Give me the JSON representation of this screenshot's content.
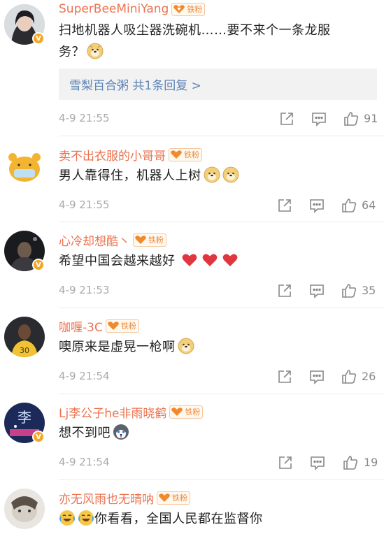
{
  "comments": [
    {
      "username": "SuperBeeMiniYang",
      "badge": "铁粉",
      "text": "扫地机器人吸尘器洗碗机……要不来个一条龙服务？",
      "emoticons": [
        "doge"
      ],
      "reply_link": "雪梨百合粥  共1条回复 >",
      "time": "4-9 21:55",
      "likes": "91",
      "verified": "V"
    },
    {
      "username": "卖不出衣服的小哥哥",
      "badge": "铁粉",
      "text": "男人靠得住，机器人上树",
      "emoticons": [
        "doge",
        "doge"
      ],
      "time": "4-9 21:55",
      "likes": "64"
    },
    {
      "username": "心冷却想酷丶",
      "badge": "铁粉",
      "text": "希望中国会越来越好",
      "emoticons": [
        "heart",
        "heart",
        "heart"
      ],
      "time": "4-9 21:53",
      "likes": "35",
      "verified": "V"
    },
    {
      "username": "咖喱-3C",
      "badge": "铁粉",
      "text": "噢原来是虚晃一枪啊",
      "emoticons": [
        "doge"
      ],
      "time": "4-9 21:54",
      "likes": "26"
    },
    {
      "username": "Lj李公子he非雨晓鹤",
      "badge": "铁粉",
      "text": "想不到吧",
      "emoticons": [
        "husky"
      ],
      "time": "4-9 21:54",
      "likes": "19",
      "verified": "V",
      "avatar_text": "李"
    },
    {
      "username": "亦无风雨也无晴呐",
      "badge": "铁粉",
      "text": "你看看，全国人民都在监督你",
      "emoticons": [
        "laugh-cry",
        "laugh-cry"
      ],
      "time": "",
      "likes": ""
    }
  ],
  "colors": {
    "username": "#eb7350",
    "reply_link": "#5c83b4",
    "meta": "#aaaaaa",
    "verified_badge": "#f5a623"
  },
  "icons": [
    "share-icon",
    "comment-icon",
    "like-icon"
  ]
}
